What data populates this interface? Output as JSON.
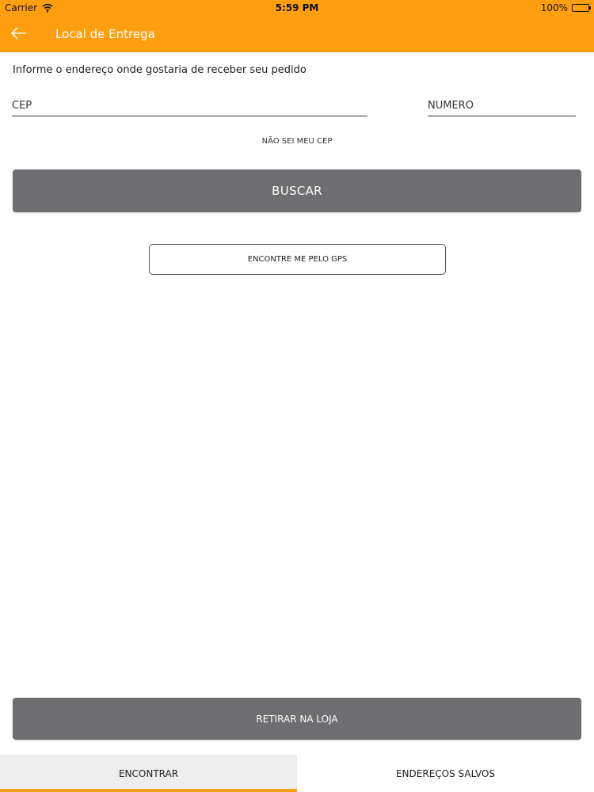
{
  "status_bar": {
    "carrier": "Carrier",
    "time": "5:59 PM",
    "battery": "100%",
    "battery_level": 1.0
  },
  "header": {
    "title": "Local de Entrega",
    "back_icon": "arrow-left-icon",
    "background_color": "#FF9F10"
  },
  "form": {
    "instruction": "Informe o endereço onde gostaria de receber seu pedido",
    "cep_placeholder": "CEP",
    "cep_value": "",
    "numero_placeholder": "NÚMERO",
    "numero_value": "",
    "no_cep_link": "NÃO SEI MEU CEP",
    "search_label": "BUSCAR",
    "gps_label": "ENCONTRE ME PELO GPS"
  },
  "pickup_label": "RETIRAR NA LOJA",
  "tabs": [
    {
      "label": "ENCONTRAR",
      "active": true
    },
    {
      "label": "ENDEREÇOS SALVOS",
      "active": false
    }
  ],
  "colors": {
    "accent": "#FF9F10",
    "button": "#6E6D70"
  }
}
